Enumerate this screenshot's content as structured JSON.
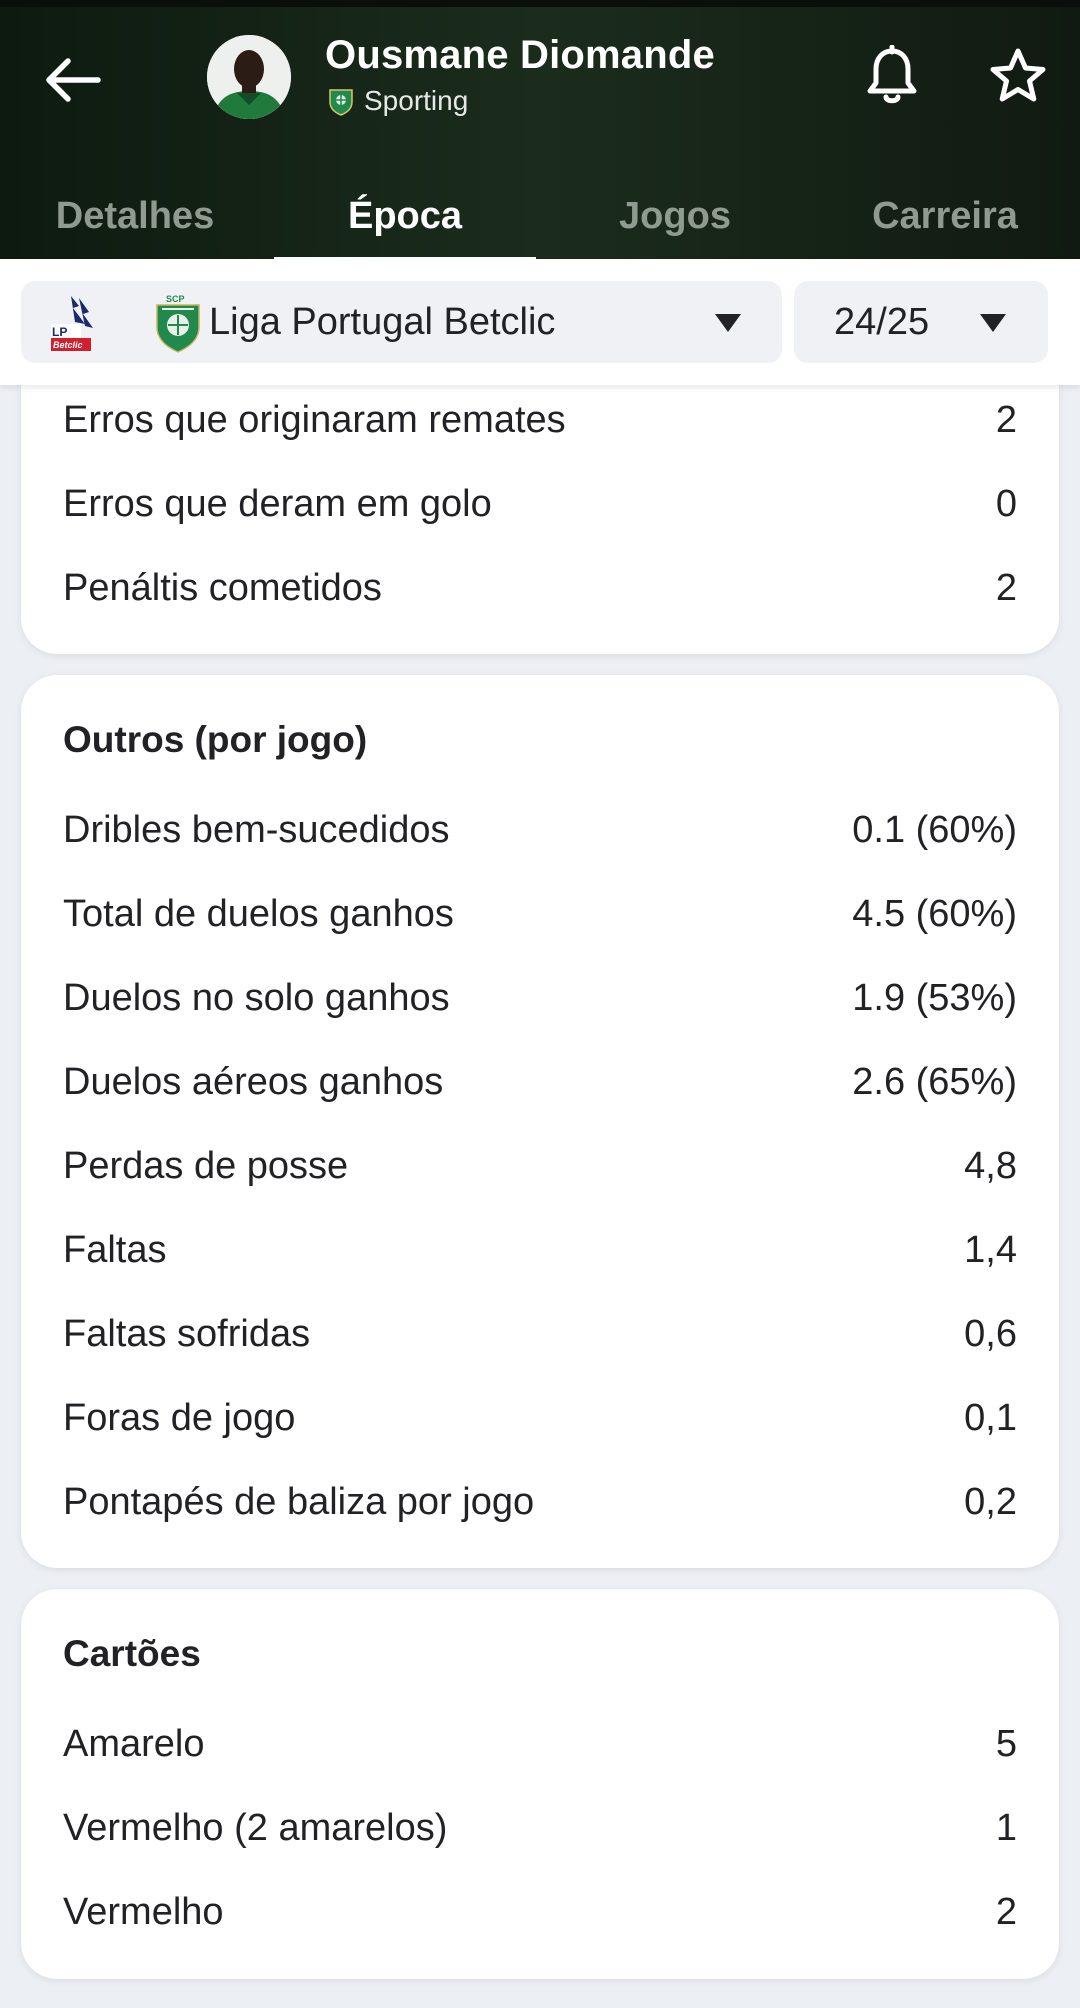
{
  "header": {
    "player_name": "Ousmane Diomande",
    "team_name": "Sporting",
    "icons": {
      "back": "arrow-left-icon",
      "notify": "bell-icon",
      "favorite": "star-icon"
    }
  },
  "tabs": [
    {
      "label": "Detalhes"
    },
    {
      "label": "Época"
    },
    {
      "label": "Jogos"
    },
    {
      "label": "Carreira"
    }
  ],
  "active_tab": "Época",
  "filters": {
    "competition": "Liga Portugal Betclic",
    "season": "24/25"
  },
  "sections": {
    "discipline_tail": {
      "rows": [
        {
          "label": "Erros que originaram remates",
          "value": "2"
        },
        {
          "label": "Erros que deram em golo",
          "value": "0"
        },
        {
          "label": "Penáltis cometidos",
          "value": "2"
        }
      ]
    },
    "outros": {
      "title": "Outros (por jogo)",
      "rows": [
        {
          "label": "Dribles bem-sucedidos",
          "value": "0.1 (60%)"
        },
        {
          "label": "Total de duelos ganhos",
          "value": "4.5 (60%)"
        },
        {
          "label": "Duelos no solo ganhos",
          "value": "1.9 (53%)"
        },
        {
          "label": "Duelos aéreos ganhos",
          "value": "2.6 (65%)"
        },
        {
          "label": "Perdas de posse",
          "value": "4,8"
        },
        {
          "label": "Faltas",
          "value": "1,4"
        },
        {
          "label": "Faltas sofridas",
          "value": "0,6"
        },
        {
          "label": "Foras de jogo",
          "value": "0,1"
        },
        {
          "label": "Pontapés de baliza por jogo",
          "value": "0,2"
        }
      ]
    },
    "cartoes": {
      "title": "Cartões",
      "rows": [
        {
          "label": "Amarelo",
          "value": "5"
        },
        {
          "label": "Vermelho (2 amarelos)",
          "value": "1"
        },
        {
          "label": "Vermelho",
          "value": "2"
        }
      ]
    }
  },
  "colors": {
    "header_bg": "#1b2c1c",
    "page_bg": "#eceff4",
    "card_bg": "#ffffff",
    "tab_active": "#ffffff",
    "tab_inactive": "#8f9a90",
    "sporting_green": "#1f8a4c"
  }
}
